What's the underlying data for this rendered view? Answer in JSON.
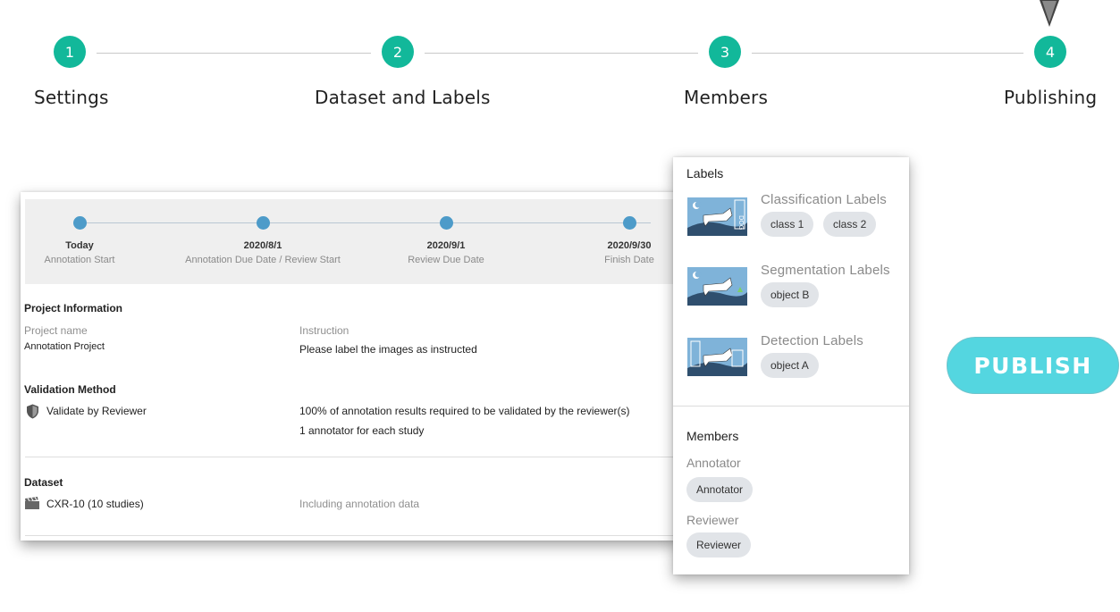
{
  "stepper": {
    "steps": [
      {
        "number": "1",
        "label": "Settings"
      },
      {
        "number": "2",
        "label": "Dataset and Labels"
      },
      {
        "number": "3",
        "label": "Members"
      },
      {
        "number": "4",
        "label": "Publishing"
      }
    ],
    "accent_color": "#12b89a"
  },
  "timeline": [
    {
      "date": "Today",
      "caption": "Annotation Start"
    },
    {
      "date": "2020/8/1",
      "caption": "Annotation Due Date / Review Start"
    },
    {
      "date": "2020/9/1",
      "caption": "Review Due Date"
    },
    {
      "date": "2020/9/30",
      "caption": "Finish Date"
    }
  ],
  "project_info": {
    "heading": "Project Information",
    "name_label": "Project name",
    "name_value": "Annotation Project",
    "instruction_label": "Instruction",
    "instruction_value": "Please label the images as instructed"
  },
  "validation": {
    "heading": "Validation Method",
    "method": "Validate by Reviewer",
    "method_icon": "shield-icon",
    "requirement": "100% of annotation results required to be validated by the reviewer(s)",
    "annotators": "1 annotator for each study"
  },
  "dataset": {
    "heading": "Dataset",
    "icon": "clapperboard-icon",
    "name": "CXR-10  (10 studies)",
    "note": "Including annotation data"
  },
  "labels_panel": {
    "heading": "Labels",
    "groups": [
      {
        "title": "Classification Labels",
        "chips": [
          "class 1",
          "class 2"
        ]
      },
      {
        "title": "Segmentation Labels",
        "chips": [
          "object B"
        ]
      },
      {
        "title": "Detection Labels",
        "chips": [
          "object A"
        ]
      }
    ],
    "members_heading": "Members",
    "roles": [
      {
        "title": "Annotator",
        "chip": "Annotator"
      },
      {
        "title": "Reviewer",
        "chip": "Reviewer"
      }
    ]
  },
  "publish_button": {
    "label": "PUBLISH",
    "color": "#54d6e0"
  }
}
